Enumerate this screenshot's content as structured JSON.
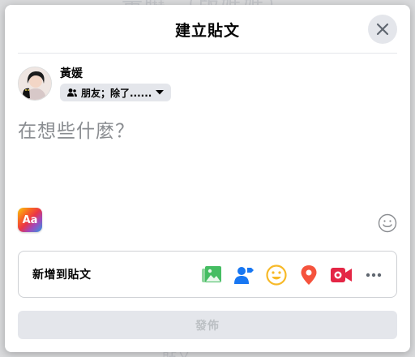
{
  "background": {
    "top_text": "黃曉 （版媽媽）",
    "bottom_text": "貼文"
  },
  "modal": {
    "title": "建立貼文"
  },
  "author": {
    "name": "黃媛",
    "privacy_label": "朋友；除了......"
  },
  "composer": {
    "placeholder": "在想些什麼？"
  },
  "toolbar": {
    "text_style_label": "Aa"
  },
  "add_to_post": {
    "label": "新增到貼文",
    "icons": [
      "photo-video-icon",
      "tag-people-icon",
      "feeling-icon",
      "check-in-icon",
      "live-video-icon",
      "more-icon"
    ]
  },
  "publish": {
    "label": "發佈"
  },
  "colors": {
    "photo": "#45bd62",
    "tag": "#1877f2",
    "feeling": "#f7b928",
    "checkin": "#f5533d",
    "live": "#e42645",
    "disabled_text": "#bcc0c4"
  }
}
